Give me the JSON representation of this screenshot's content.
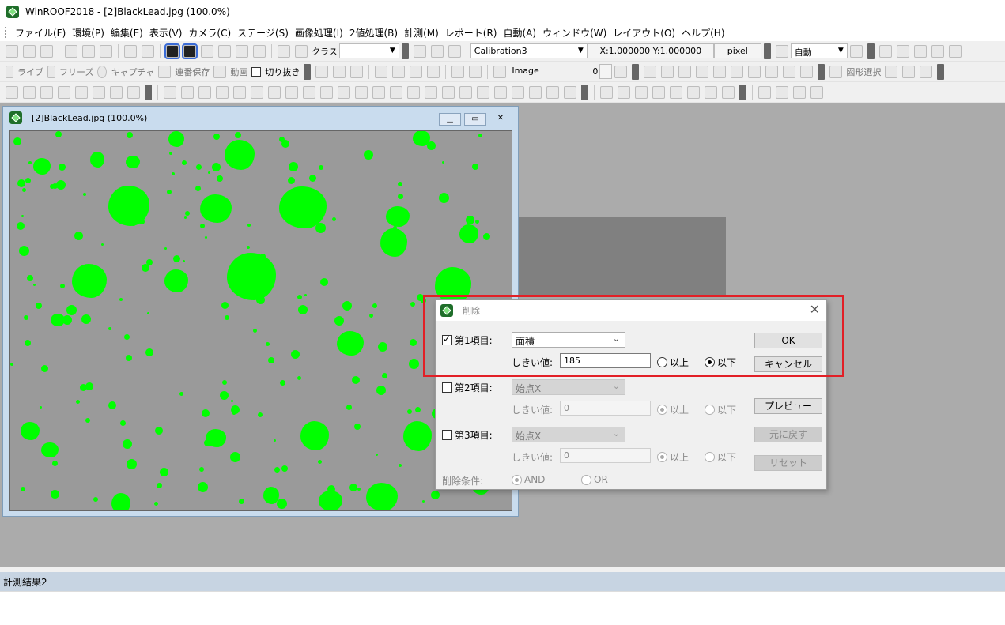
{
  "app": {
    "title": "WinROOF2018 - [2]BlackLead.jpg (100.0%)"
  },
  "menu": [
    "ファイル(F)",
    "環境(P)",
    "編集(E)",
    "表示(V)",
    "カメラ(C)",
    "ステージ(S)",
    "画像処理(I)",
    "2値処理(B)",
    "計測(M)",
    "レポート(R)",
    "自動(A)",
    "ウィンドウ(W)",
    "レイアウト(O)",
    "ヘルプ(H)"
  ],
  "toolbar1": {
    "class_label": "クラス",
    "calibration": "Calibration3",
    "xy_scale": "X:1.000000 Y:1.000000",
    "unit": "pixel",
    "zoom": "自動"
  },
  "toolbar2": {
    "live": "ライブ",
    "freeze": "フリーズ",
    "capture": "キャプチャ",
    "continuous_save": "連番保存",
    "movie": "動画",
    "crop": "切り抜き",
    "image_mode": "Image",
    "spin_value": "0",
    "shape_select": "図形選択"
  },
  "image_window": {
    "title": "[2]BlackLead.jpg (100.0%)"
  },
  "results": {
    "title": "計測結果2"
  },
  "dialog": {
    "title": "削除",
    "item1": {
      "label": "第1項目:",
      "checked": true,
      "parameter": "面積",
      "threshold_label": "しきい値:",
      "threshold": "185",
      "above": "以上",
      "below": "以下",
      "selected": "below"
    },
    "item2": {
      "label": "第2項目:",
      "checked": false,
      "parameter": "始点X",
      "threshold_label": "しきい値:",
      "threshold": "0",
      "above": "以上",
      "below": "以下",
      "selected": "above"
    },
    "item3": {
      "label": "第3項目:",
      "checked": false,
      "parameter": "始点X",
      "threshold_label": "しきい値:",
      "threshold": "0",
      "above": "以上",
      "below": "以下",
      "selected": "above"
    },
    "condition": {
      "label": "削除条件:",
      "and": "AND",
      "or": "OR",
      "selected": "and"
    },
    "buttons": {
      "ok": "OK",
      "cancel": "キャンセル",
      "preview": "プレビュー",
      "undo": "元に戻す",
      "reset": "リセット"
    }
  },
  "colors": {
    "highlight": "#e21f26",
    "grain": "#00ff00",
    "workspace": "#ababab"
  }
}
